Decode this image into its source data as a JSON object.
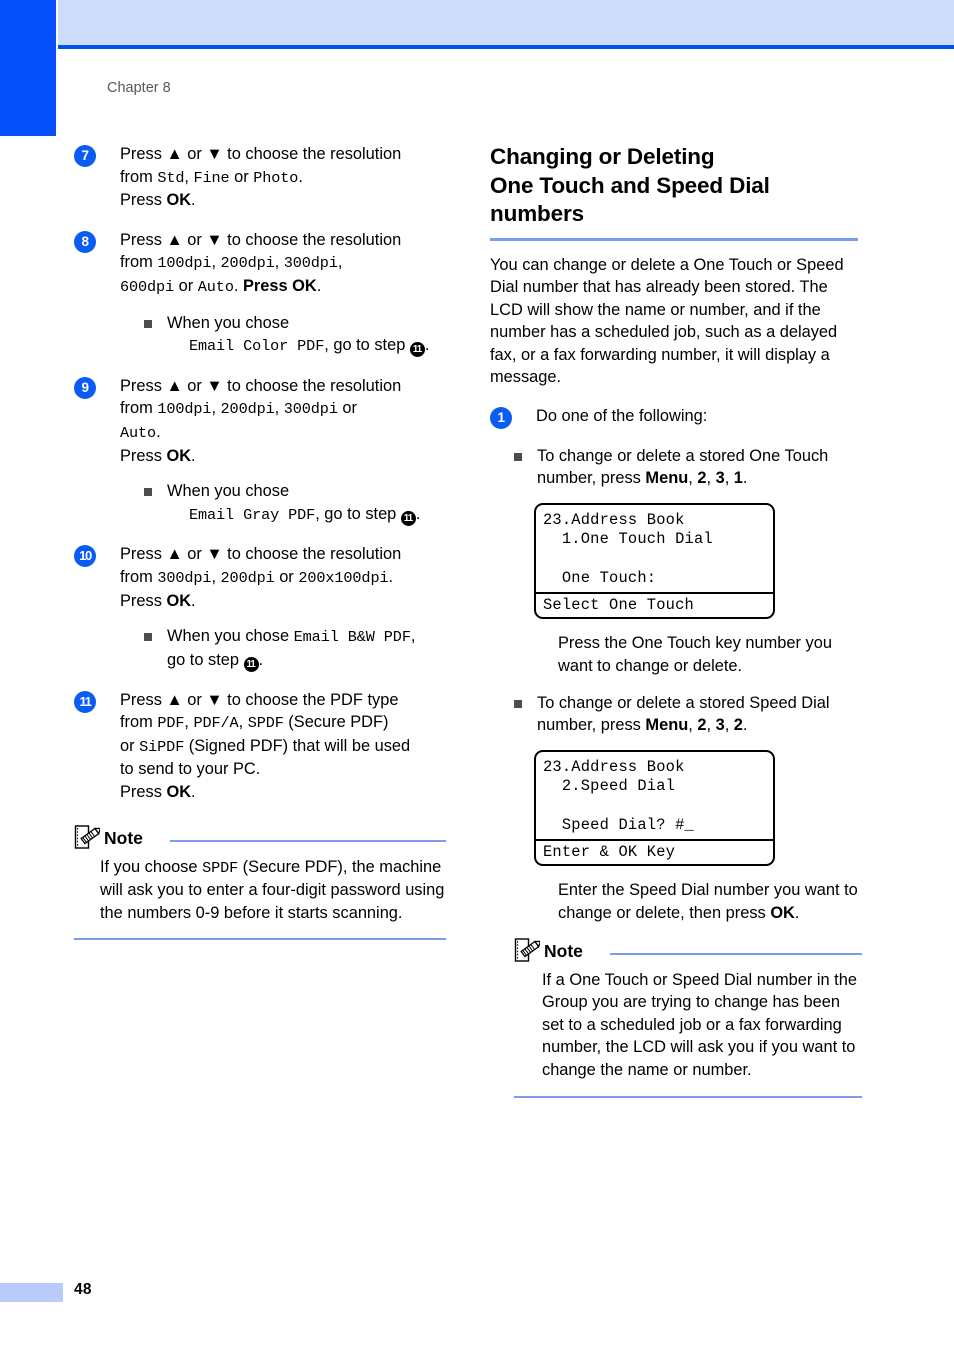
{
  "page": {
    "chapter_label": "Chapter 8",
    "page_number": "48",
    "accent_blue": "#0550fb",
    "header_band_blue": "#cedcfa",
    "rule_blue": "#7a9ce9",
    "step_badge_blue": "#0a5cf5"
  },
  "left_column": {
    "steps": [
      {
        "number": "7",
        "text_runs": {
          "l1_a": "Press ",
          "l1_arrows": "▲ or ▼",
          "l1_b": " to choose the resolution",
          "l2_a": "from ",
          "l2_m1": "Std",
          "l2_sep1": ", ",
          "l2_m2": "Fine",
          "l2_b": " or ",
          "l2_m3": "Photo",
          "l2_end": ".",
          "l3_a": "Press ",
          "l3_ok": "OK",
          "l3_end": "."
        }
      },
      {
        "number": "8",
        "text_runs": {
          "l1_a": "Press ",
          "l1_arrows": "▲ or ▼",
          "l1_b": " to choose the resolution",
          "l2_a": "from ",
          "l2_m1": "100dpi",
          "l2_sep1": ", ",
          "l2_m2": "200dpi",
          "l2_sep2": ", ",
          "l2_m3": "300dpi",
          "l2_sep3": ",",
          "l3_m4": "600dpi",
          "l3_b": " or ",
          "l3_m5": "Auto",
          "l3_c": ". ",
          "l3_press": "Press ",
          "l3_ok": "OK",
          "l3_end": "."
        },
        "sub": {
          "line1": "When you chose",
          "mono": "Email Color PDF",
          "tail_a": ", go to step ",
          "ref": "11",
          "tail_b": "."
        }
      },
      {
        "number": "9",
        "text_runs": {
          "l1_a": "Press ",
          "l1_arrows": "▲ or ▼",
          "l1_b": " to choose the resolution",
          "l2_a": "from ",
          "l2_m1": "100dpi",
          "l2_sep1": ", ",
          "l2_m2": "200dpi",
          "l2_sep2": ", ",
          "l2_m3": "300dpi",
          "l2_b": " or",
          "l3_m4": "Auto",
          "l3_c": ".",
          "l4_press": "Press ",
          "l4_ok": "OK",
          "l4_end": "."
        },
        "sub": {
          "line1": "When you chose",
          "mono": "Email Gray PDF",
          "tail_a": ", go to step ",
          "ref": "11",
          "tail_b": "."
        }
      },
      {
        "number": "10",
        "text_runs": {
          "l1_a": "Press ",
          "l1_arrows": "▲ or ▼",
          "l1_b": " to choose the resolution",
          "l2_a": "from ",
          "l2_m1": "300dpi",
          "l2_sep1": ", ",
          "l2_m2": "200dpi",
          "l2_b": " or ",
          "l2_m3": "200x100dpi",
          "l2_end": ".",
          "l3_press": "Press ",
          "l3_ok": "OK",
          "l3_end": "."
        },
        "sub": {
          "line1_a": "When you chose ",
          "mono": "Email B&W PDF",
          "line1_b": ",",
          "line2_a": "go to step ",
          "ref": "11",
          "line2_b": "."
        }
      },
      {
        "number": "11",
        "text_runs": {
          "l1_a": "Press ",
          "l1_arrows": "▲ or ▼",
          "l1_b": " to choose the PDF type",
          "l2_a": "from ",
          "l2_m1": "PDF",
          "l2_sep1": ", ",
          "l2_m2": "PDF/A",
          "l2_sep2": ", ",
          "l2_m3": "SPDF",
          "l2_b": " (Secure PDF)",
          "l3_a": "or ",
          "l3_m4": "SiPDF",
          "l3_b": " (Signed PDF) that will be used",
          "l4": "to send to your PC.",
          "l5_press": "Press ",
          "l5_ok": "OK",
          "l5_end": "."
        }
      }
    ],
    "note": {
      "icon": "note-pencil-icon",
      "title": "Note",
      "body_a": "If you choose ",
      "body_mono": "SPDF",
      "body_b": " (Secure PDF), the machine will ask you to enter a four-digit password using the numbers 0-9 before it starts scanning."
    }
  },
  "right_column": {
    "section_title_l1": "Changing or Deleting",
    "section_title_l2": "One Touch and Speed Dial",
    "section_title_l3": "numbers",
    "intro_paragraph": "You can change or delete a One Touch or Speed Dial number that has already been stored. The LCD will show the name or number, and if the number has a scheduled job, such as a delayed fax, or a fax forwarding number, it will display a message.",
    "step": {
      "number": "1",
      "lead": "Do one of the following:"
    },
    "bullets": [
      {
        "text_a": "To change or delete a stored One Touch number, press ",
        "menu": "Menu",
        "sep1": ", ",
        "k1": "2",
        "sep2": ", ",
        "k2": "3",
        "sep3": ", ",
        "k3": "1",
        "end": "."
      },
      {
        "text_a": "To change or delete a stored Speed Dial number, press ",
        "menu": "Menu",
        "sep1": ", ",
        "k1": "2",
        "sep2": ", ",
        "k2": "3",
        "sep3": ", ",
        "k3": "2",
        "end": "."
      }
    ],
    "lcd_one_touch": {
      "lines": [
        "23.Address Book",
        "  1.One Touch Dial",
        "",
        "  One Touch:"
      ],
      "status": "Select One Touch"
    },
    "lcd_speed_dial": {
      "lines": [
        "23.Address Book",
        "  2.Speed Dial",
        "",
        "  Speed Dial? #_"
      ],
      "status": "Enter & OK Key"
    },
    "after_one_touch": "Press the One Touch key number you want to change or delete.",
    "after_speed_dial_a": "Enter the Speed Dial number you want to change or delete, then press ",
    "after_speed_dial_ok": "OK",
    "after_speed_dial_b": ".",
    "note": {
      "icon": "note-pencil-icon",
      "title": "Note",
      "body": "If a One Touch or Speed Dial number in the Group you are trying to change has been set to a scheduled job or a fax forwarding number, the LCD will ask you if you want to change the name or number."
    }
  }
}
